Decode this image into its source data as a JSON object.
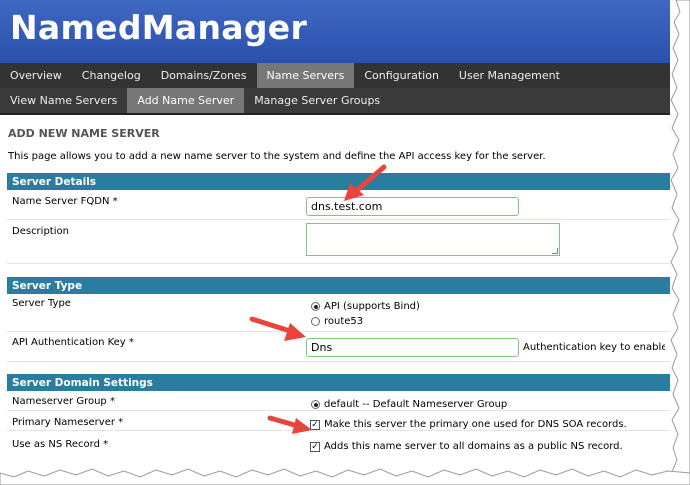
{
  "app": {
    "title": "NamedManager"
  },
  "nav_primary": [
    {
      "label": "Overview",
      "active": false
    },
    {
      "label": "Changelog",
      "active": false
    },
    {
      "label": "Domains/Zones",
      "active": false
    },
    {
      "label": "Name Servers",
      "active": true
    },
    {
      "label": "Configuration",
      "active": false
    },
    {
      "label": "User Management",
      "active": false
    }
  ],
  "nav_secondary": [
    {
      "label": "View Name Servers",
      "active": false
    },
    {
      "label": "Add Name Server",
      "active": true
    },
    {
      "label": "Manage Server Groups",
      "active": false
    }
  ],
  "page": {
    "title": "ADD NEW NAME SERVER",
    "intro": "This page allows you to add a new name server to the system and define the API access key for the server."
  },
  "sections": {
    "details": {
      "title": "Server Details",
      "fqdn_label": "Name Server FQDN *",
      "fqdn_value": "dns.test.com",
      "description_label": "Description",
      "description_value": ""
    },
    "type": {
      "title": "Server Type",
      "server_type_label": "Server Type",
      "options": [
        {
          "label": "API (supports Bind)",
          "checked": true
        },
        {
          "label": "route53",
          "checked": false
        }
      ],
      "api_key_label": "API Authentication Key *",
      "api_key_value": "Dns",
      "api_key_hint": "Authentication key to enable t"
    },
    "domain": {
      "title": "Server Domain Settings",
      "group_label": "Nameserver Group *",
      "group_option": "default -- Default Nameserver Group",
      "group_checked": true,
      "primary_label": "Primary Nameserver *",
      "primary_text": "Make this server the primary one used for DNS SOA records.",
      "primary_checked": true,
      "ns_label": "Use as NS Record *",
      "ns_text": "Adds this name server to all domains as a public NS record.",
      "ns_checked": true
    }
  },
  "colors": {
    "header": "#2f58b5",
    "nav": "#333333",
    "nav_active": "#777777",
    "section_bar": "#2b7da0",
    "input_border": "#7cc77a",
    "arrow": "#e8453c"
  }
}
